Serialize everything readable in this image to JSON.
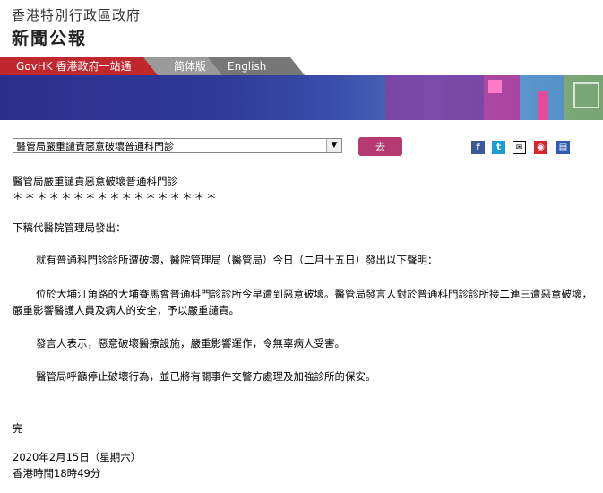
{
  "header": {
    "site_title": "香港特別行政區政府",
    "site_subtitle": "新聞公報"
  },
  "nav": {
    "govhk": "GovHK 香港政府一站通",
    "simplified": "简体版",
    "english": "English"
  },
  "toolbar": {
    "select_value": "醫管局嚴重譴責惡意破壞普通科門診",
    "go_label": "去",
    "share_icons": [
      "facebook-icon",
      "twitter-icon",
      "email-icon",
      "weibo-icon",
      "print-icon"
    ]
  },
  "article": {
    "title": "醫管局嚴重譴責惡意破壞普通科門診",
    "stars": "＊＊＊＊＊＊＊＊＊＊＊＊＊＊＊＊＊",
    "intro": "下稿代醫院管理局發出：",
    "p1": "就有普通科門診診所遭破壞，醫院管理局（醫管局）今日（二月十五日）發出以下聲明：",
    "p2": "位於大埔汀角路的大埔賽馬會普通科門診診所今早遭到惡意破壞。醫管局發言人對於普通科門診診所接二連三遭惡意破壞，嚴重影響醫護人員及病人的安全，予以嚴重譴責。",
    "p3": "發言人表示，惡意破壞醫療設施，嚴重影響運作，令無辜病人受害。",
    "p4": "醫管局呼籲停止破壞行為，並已將有關事件交警方處理及加強診所的保安。",
    "end": "完",
    "date": "2020年2月15日（星期六）",
    "time": "香港時間18時49分"
  }
}
